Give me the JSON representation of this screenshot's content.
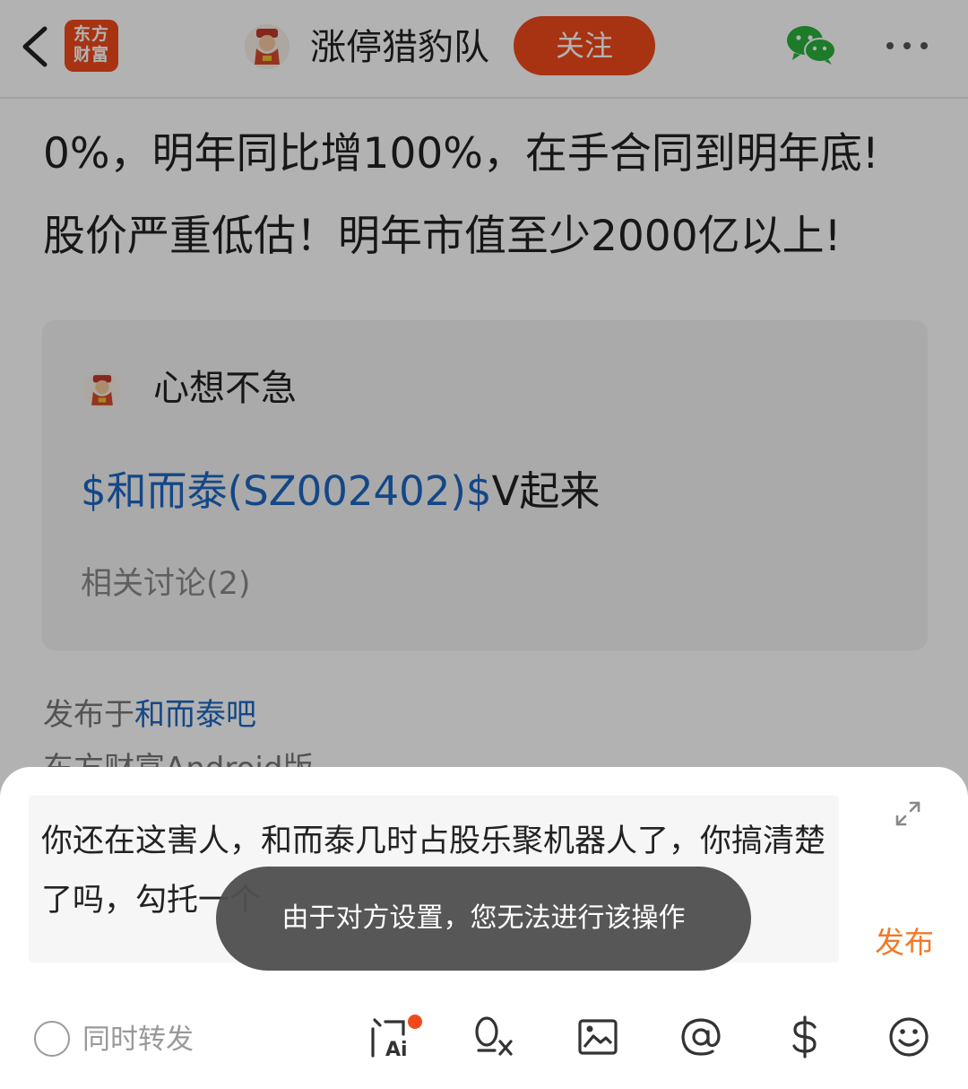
{
  "header": {
    "logo_text_line1": "东方",
    "logo_text_line2": "财富",
    "author_name": "涨停猎豹队",
    "follow_label": "关注"
  },
  "post": {
    "line1": "0%，明年同比增100%，在手合同到明年底!",
    "line2": "股价严重低估！明年市值至少2000亿以上!"
  },
  "quote": {
    "user": "心想不急",
    "stock_link": "$和而泰(SZ002402)$",
    "body_rest": "V起来",
    "related": "相关讨论(2)"
  },
  "meta": {
    "publish_prefix": "发布于",
    "publish_bar": "和而泰吧",
    "platform": "东方财富Android版"
  },
  "reply": {
    "text": "你还在这害人，和而泰几时占股乐聚机器人了，你搞清楚了吗，勾托一个",
    "publish_label": "发布",
    "repost_label": "同时转发",
    "toolbar_icons": [
      "ask-ai-icon",
      "stock-search-icon",
      "image-icon",
      "at-icon",
      "dollar-icon",
      "emoji-icon"
    ]
  },
  "toast": {
    "message": "由于对方设置，您无法进行该操作"
  },
  "colors": {
    "brand_orange": "#f04a1c",
    "link_blue": "#1d66c2",
    "publish_orange": "#f07a28"
  }
}
